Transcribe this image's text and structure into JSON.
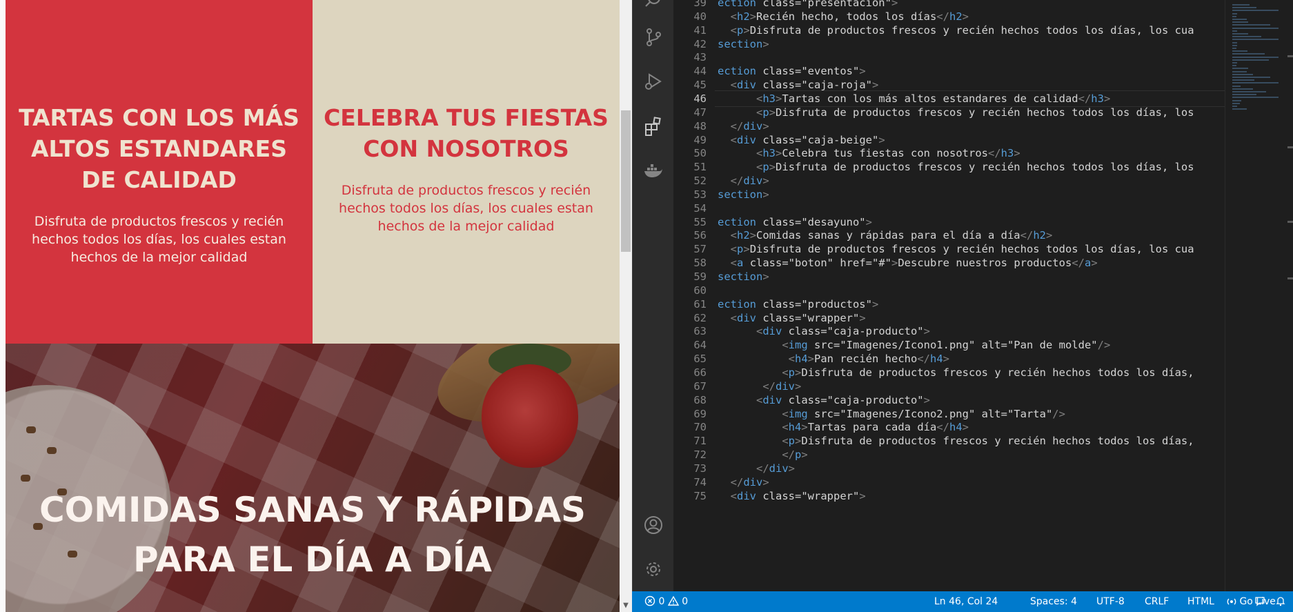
{
  "preview": {
    "box_red": {
      "title": "Tartas con los más altos estandares de calidad",
      "text": "Disfruta de productos frescos y recién hechos todos los días, los cuales estan hechos de la mejor calidad"
    },
    "box_beige": {
      "title": "Celebra tus fiestas con nosotros",
      "text": "Disfruta de productos frescos y recién hechos todos los días, los cuales estan hechos de la mejor calidad"
    },
    "hero": {
      "title": "Comidas sanas y rápidas para el día a día"
    }
  },
  "editor": {
    "active_line": 46,
    "lines": [
      {
        "n": "39",
        "code": "ection class=\"presentacion\">"
      },
      {
        "n": "40",
        "code": "  <h2>Recién hecho, todos los días</h2>"
      },
      {
        "n": "41",
        "code": "  <p>Disfruta de productos frescos y recién hechos todos los días, los cua"
      },
      {
        "n": "42",
        "code": "section>"
      },
      {
        "n": "43",
        "code": ""
      },
      {
        "n": "44",
        "code": "ection class=\"eventos\">"
      },
      {
        "n": "45",
        "code": "  <div class=\"caja-roja\">"
      },
      {
        "n": "46",
        "code": "      <h3>Tartas con los más altos estandares de calidad</h3>"
      },
      {
        "n": "47",
        "code": "      <p>Disfruta de productos frescos y recién hechos todos los días, los"
      },
      {
        "n": "48",
        "code": "  </div>"
      },
      {
        "n": "49",
        "code": "  <div class=\"caja-beige\">"
      },
      {
        "n": "50",
        "code": "      <h3>Celebra tus fiestas con nosotros</h3>"
      },
      {
        "n": "51",
        "code": "      <p>Disfruta de productos frescos y recién hechos todos los días, los"
      },
      {
        "n": "52",
        "code": "  </div>"
      },
      {
        "n": "53",
        "code": "section>"
      },
      {
        "n": "54",
        "code": ""
      },
      {
        "n": "55",
        "code": "ection class=\"desayuno\">"
      },
      {
        "n": "56",
        "code": "  <h2>Comidas sanas y rápidas para el día a día</h2>"
      },
      {
        "n": "57",
        "code": "  <p>Disfruta de productos frescos y recién hechos todos los días, los cua"
      },
      {
        "n": "58",
        "code": "  <a class=\"boton\" href=\"#\">Descubre nuestros productos</a>"
      },
      {
        "n": "59",
        "code": "section>"
      },
      {
        "n": "60",
        "code": ""
      },
      {
        "n": "61",
        "code": "ection class=\"productos\">"
      },
      {
        "n": "62",
        "code": "  <div class=\"wrapper\">"
      },
      {
        "n": "63",
        "code": "      <div class=\"caja-producto\">"
      },
      {
        "n": "64",
        "code": "          <img src=\"Imagenes/Icono1.png\" alt=\"Pan de molde\"/>"
      },
      {
        "n": "65",
        "code": "           <h4>Pan recién hecho</h4>"
      },
      {
        "n": "66",
        "code": "          <p>Disfruta de productos frescos y recién hechos todos los días,"
      },
      {
        "n": "67",
        "code": "       </div>"
      },
      {
        "n": "68",
        "code": "      <div class=\"caja-producto\">"
      },
      {
        "n": "69",
        "code": "          <img src=\"Imagenes/Icono2.png\" alt=\"Tarta\"/>"
      },
      {
        "n": "70",
        "code": "          <h4>Tartas para cada día</h4>"
      },
      {
        "n": "71",
        "code": "          <p>Disfruta de productos frescos y recién hechos todos los días,"
      },
      {
        "n": "72",
        "code": "          </p>"
      },
      {
        "n": "73",
        "code": "      </div>"
      },
      {
        "n": "74",
        "code": "  </div>"
      },
      {
        "n": "75",
        "code": "  <div class=\"wrapper\">"
      }
    ]
  },
  "statusbar": {
    "errors": "0",
    "warnings": "0",
    "position": "Ln 46, Col 24",
    "spaces": "Spaces: 4",
    "encoding": "UTF-8",
    "eol": "CRLF",
    "language": "HTML",
    "golive": "Go Live"
  },
  "activity_bar": {
    "icons": [
      "search-icon",
      "source-control-icon",
      "run-debug-icon",
      "extensions-icon",
      "docker-icon",
      "account-icon",
      "settings-gear-icon"
    ]
  },
  "colors": {
    "red": "#d3343e",
    "beige": "#ddd5bf",
    "statusbar": "#007acc",
    "editor_bg": "#1e1e1e"
  }
}
